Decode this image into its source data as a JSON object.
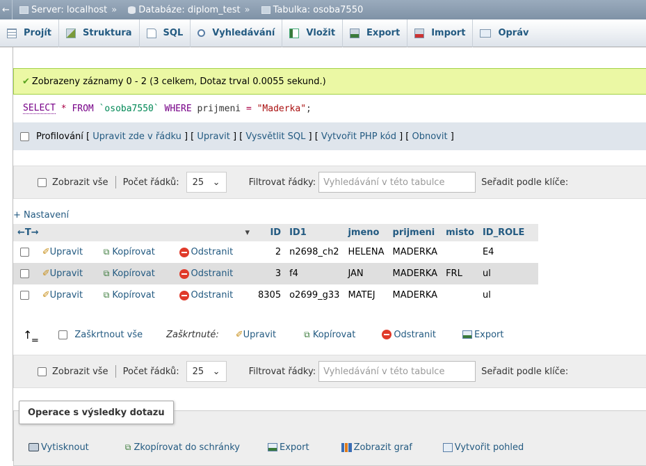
{
  "breadcrumb": {
    "back": "←",
    "server": "Server: localhost",
    "database": "Databáze: diplom_test",
    "table": "Tabulka: osoba7550",
    "sep": "»"
  },
  "tabs": [
    {
      "label": "Projít",
      "icon": "browse-icon"
    },
    {
      "label": "Struktura",
      "icon": "structure-icon"
    },
    {
      "label": "SQL",
      "icon": "sql-icon"
    },
    {
      "label": "Vyhledávání",
      "icon": "search-icon"
    },
    {
      "label": "Vložit",
      "icon": "insert-icon"
    },
    {
      "label": "Export",
      "icon": "export-icon"
    },
    {
      "label": "Import",
      "icon": "import-icon"
    },
    {
      "label": "Opráv",
      "icon": "operations-icon"
    }
  ],
  "message": "Zobrazeny záznamy 0 - 2 (3 celkem, Dotaz trval 0.0055 sekund.)",
  "sql": {
    "select": "SELECT",
    "star": "*",
    "from": "FROM",
    "table": "`osoba7550`",
    "where": "WHERE",
    "column": "prijmeni",
    "eq": "=",
    "value": "\"Maderka\"",
    "end": ";"
  },
  "profiling": {
    "label": "Profilování",
    "links": [
      "Upravit zde v řádku",
      "Upravit",
      "Vysvětlit SQL",
      "Vytvořit PHP kód",
      "Obnovit"
    ]
  },
  "nav": {
    "show_all": "Zobrazit vše",
    "rows_label": "Počet řádků:",
    "rows_value": "25",
    "filter_label": "Filtrovat řádky:",
    "filter_placeholder": "Vyhledávání v této tabulce",
    "sort_label": "Seřadit podle klíče:"
  },
  "settings_link": "+ Nastavení",
  "table": {
    "arrows": "←T→",
    "columns": [
      "ID",
      "ID1",
      "jmeno",
      "prijmeni",
      "misto",
      "ID_ROLE"
    ],
    "actions": {
      "edit": "Upravit",
      "copy": "Kopírovat",
      "delete": "Odstranit"
    },
    "rows": [
      {
        "ID": "2",
        "ID1": "n2698_ch2",
        "jmeno": "HELENA",
        "prijmeni": "MADERKA",
        "misto": "",
        "ID_ROLE": "E4"
      },
      {
        "ID": "3",
        "ID1": "f4",
        "jmeno": "JAN",
        "prijmeni": "MADERKA",
        "misto": "FRL",
        "ID_ROLE": "ul"
      },
      {
        "ID": "8305",
        "ID1": "o2699_g33",
        "jmeno": "MATEJ",
        "prijmeni": "MADERKA",
        "misto": "",
        "ID_ROLE": "ul"
      }
    ]
  },
  "bulk": {
    "check_all": "Zaškrtnout vše",
    "checked": "Zaškrtnuté:",
    "edit": "Upravit",
    "copy": "Kopírovat",
    "delete": "Odstranit",
    "export": "Export"
  },
  "operations": {
    "title": "Operace s výsledky dotazu",
    "print": "Vytisknout",
    "copy_clipboard": "Zkopírovat do schránky",
    "export": "Export",
    "chart": "Zobrazit graf",
    "create_view": "Vytvořit pohled"
  }
}
